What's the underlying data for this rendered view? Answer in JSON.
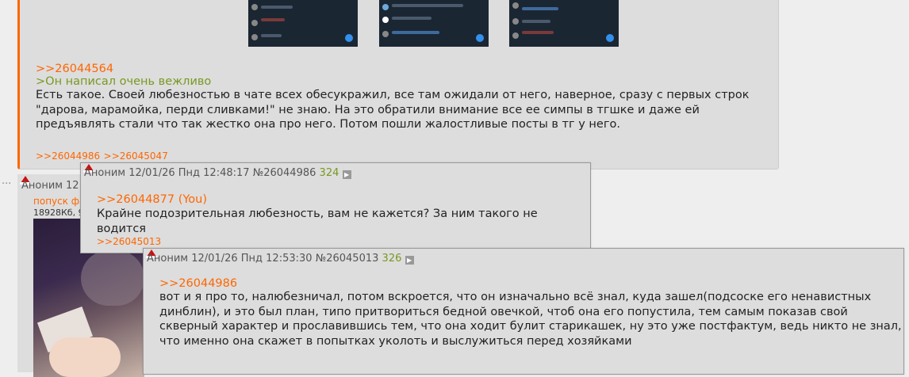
{
  "main_post": {
    "reply_link": ">>26044564",
    "greentext": ">Он написал очень вежливо",
    "body_lines": [
      "Есть такое. Своей любезностью в чате всех обесукражил, все там ожидали от него, наверное, сразу с первых строк",
      "\"дарова, марамойка, перди сливками!\" не знаю. На это обратили внимание все ее симпы в тгшке и даже ей",
      "предъявлять стали что так жестко она про него. Потом пошли жалостливые посты в тг у него."
    ],
    "replies": [
      ">>26044986",
      ">>26045047"
    ]
  },
  "background_post": {
    "dots": "...",
    "author": "Аноним",
    "date_fragment": "12",
    "file_name": "попуск фа",
    "file_info": "18928Кб, 9"
  },
  "popup1": {
    "author": "Аноним",
    "date": "12/01/26 Пнд 12:48:17",
    "post_number": "№26044986",
    "index": "324",
    "reply_link": ">>26044877 (You)",
    "body": "Крайне подозрительная любезность, вам не кажется? За ним такого не водится",
    "replies": [
      ">>26045013"
    ]
  },
  "popup2": {
    "author": "Аноним",
    "date": "12/01/26 Пнд 12:53:30",
    "post_number": "№26045013",
    "index": "326",
    "reply_link": ">>26044986",
    "body_lines": [
      "вот и я про то, налюбезничал, потом вскроется, что он изначально всё знал, куда зашел(подсоске его ненавистных",
      "динблин), и это был план, типо притвориться бедной овечкой, чтоб она его попустила, тем самым показав свой",
      "скверный характер и прославившись тем, что она ходит булит старикашек, ну это уже постфактум, ведь никто не знал,",
      "что именно она скажет в попытках уколоть и выслужиться перед хозяйками"
    ]
  },
  "colors": {
    "background": "#eeeeee",
    "post_bg": "#dddddd",
    "link": "#ff6600",
    "greentext": "#789922",
    "accent_border": "#ff6600",
    "hat": "#cc1111"
  },
  "icons": [
    "santa-hat-icon",
    "play-icon"
  ]
}
